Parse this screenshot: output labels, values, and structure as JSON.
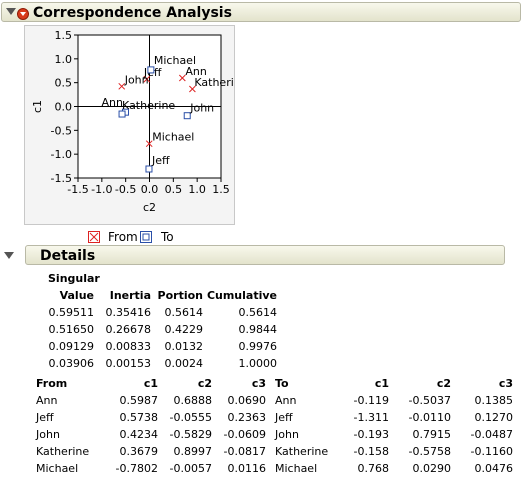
{
  "correspondence": {
    "title": "Correspondence Analysis",
    "plot": {
      "xlabel": "c2",
      "ylabel": "c1",
      "x_ticks": [
        "-1.5",
        "-1.0",
        "-0.5",
        "0.0",
        "0.5",
        "1.0",
        "1.5"
      ],
      "y_ticks": [
        "1.5",
        "1.0",
        "0.5",
        "0.0",
        "-0.5",
        "-1.0",
        "-1.5"
      ]
    },
    "legend": {
      "from": "From",
      "to": "To"
    }
  },
  "chart_data": {
    "type": "scatter",
    "xlabel": "c2",
    "ylabel": "c1",
    "xlim": [
      -1.5,
      1.5
    ],
    "ylim": [
      -1.5,
      1.5
    ],
    "series": [
      {
        "name": "From",
        "points": [
          {
            "label": "Ann",
            "x": 0.6888,
            "y": 0.5987
          },
          {
            "label": "Jeff",
            "x": -0.0555,
            "y": 0.5738
          },
          {
            "label": "John",
            "x": -0.5829,
            "y": 0.4234
          },
          {
            "label": "Katherine",
            "x": 0.8997,
            "y": 0.3679
          },
          {
            "label": "Michael",
            "x": -0.0057,
            "y": -0.7802
          }
        ]
      },
      {
        "name": "To",
        "points": [
          {
            "label": "Ann",
            "x": -0.5037,
            "y": -0.119
          },
          {
            "label": "Jeff",
            "x": -0.011,
            "y": -1.311
          },
          {
            "label": "John",
            "x": 0.7915,
            "y": -0.193
          },
          {
            "label": "Katherine",
            "x": -0.5758,
            "y": -0.158
          },
          {
            "label": "Michael",
            "x": 0.029,
            "y": 0.768
          }
        ]
      }
    ]
  },
  "details": {
    "title": "Details",
    "singular_header": "Singular",
    "columns": [
      "Value",
      "Inertia",
      "Portion",
      "Cumulative"
    ],
    "rows": [
      [
        "0.59511",
        "0.35416",
        "0.5614",
        "0.5614"
      ],
      [
        "0.51650",
        "0.26678",
        "0.4229",
        "0.9844"
      ],
      [
        "0.09129",
        "0.00833",
        "0.0132",
        "0.9976"
      ],
      [
        "0.03906",
        "0.00153",
        "0.0024",
        "1.0000"
      ]
    ],
    "from_columns": [
      "From",
      "c1",
      "c2",
      "c3"
    ],
    "from_rows": [
      [
        "Ann",
        "0.5987",
        "0.6888",
        "0.0690"
      ],
      [
        "Jeff",
        "0.5738",
        "-0.0555",
        "0.2363"
      ],
      [
        "John",
        "0.4234",
        "-0.5829",
        "-0.0609"
      ],
      [
        "Katherine",
        "0.3679",
        "0.8997",
        "-0.0817"
      ],
      [
        "Michael",
        "-0.7802",
        "-0.0057",
        "0.0116"
      ]
    ],
    "to_columns": [
      "To",
      "c1",
      "c2",
      "c3"
    ],
    "to_rows": [
      [
        "Ann",
        "-0.119",
        "-0.5037",
        "0.1385"
      ],
      [
        "Jeff",
        "-1.311",
        "-0.0110",
        "0.1270"
      ],
      [
        "John",
        "-0.193",
        "0.7915",
        "-0.0487"
      ],
      [
        "Katherine",
        "-0.158",
        "-0.5758",
        "-0.1160"
      ],
      [
        "Michael",
        "0.768",
        "0.0290",
        "0.0476"
      ]
    ]
  }
}
